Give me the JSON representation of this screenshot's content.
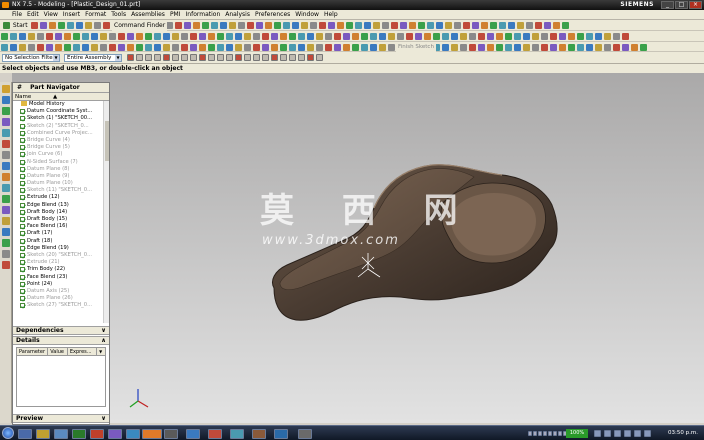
{
  "window": {
    "title": "NX 7.5 - Modeling - [Plastic_Design_01.prt]",
    "brand": "SIEMENS",
    "controls": [
      "_",
      "□",
      "×"
    ]
  },
  "menu": [
    "File",
    "Edit",
    "View",
    "Insert",
    "Format",
    "Tools",
    "Assemblies",
    "PMI",
    "Information",
    "Analysis",
    "Preferences",
    "Window",
    "Help"
  ],
  "toolbar": {
    "start_label": "Start",
    "command_finder": "Command Finder",
    "sketch_label": "Finish Sketch"
  },
  "filter": {
    "selection_filter": "No Selection Filter",
    "scope": "Entire Assembly"
  },
  "cue_line": "Select objects and use MB3, or double-click an object",
  "navigator": {
    "title": "Part Navigator",
    "column_name": "Name",
    "items": [
      {
        "label": "Model History",
        "dim": false,
        "root": true
      },
      {
        "label": "Datum Coordinate Syst...",
        "dim": false
      },
      {
        "label": "Sketch (1) \"SKETCH_00...",
        "dim": false
      },
      {
        "label": "Sketch (2) \"SKETCH_0...",
        "dim": true
      },
      {
        "label": "Combined Curve Projec...",
        "dim": true
      },
      {
        "label": "Bridge Curve (4)",
        "dim": true
      },
      {
        "label": "Bridge Curve (5)",
        "dim": true
      },
      {
        "label": "Join Curve (6)",
        "dim": true
      },
      {
        "label": "N-Sided Surface (7)",
        "dim": true
      },
      {
        "label": "Datum Plane (8)",
        "dim": true
      },
      {
        "label": "Datum Plane (9)",
        "dim": true
      },
      {
        "label": "Datum Plane (10)",
        "dim": true
      },
      {
        "label": "Sketch (11) \"SKETCH_0...",
        "dim": true
      },
      {
        "label": "Extrude (12)",
        "dim": false
      },
      {
        "label": "Edge Blend (13)",
        "dim": false
      },
      {
        "label": "Draft Body (14)",
        "dim": false
      },
      {
        "label": "Draft Body (15)",
        "dim": false
      },
      {
        "label": "Face Blend (16)",
        "dim": false
      },
      {
        "label": "Draft (17)",
        "dim": false
      },
      {
        "label": "Draft (18)",
        "dim": false
      },
      {
        "label": "Edge Blend (19)",
        "dim": false
      },
      {
        "label": "Sketch (20) \"SKETCH_0...",
        "dim": true
      },
      {
        "label": "Extrude (21)",
        "dim": true
      },
      {
        "label": "Trim Body (22)",
        "dim": false
      },
      {
        "label": "Face Blend (23)",
        "dim": false
      },
      {
        "label": "Point (24)",
        "dim": false
      },
      {
        "label": "Datum Axis (25)",
        "dim": true
      },
      {
        "label": "Datum Plane (26)",
        "dim": true
      },
      {
        "label": "Sketch (27) \"SKETCH_0...",
        "dim": true
      }
    ],
    "dependencies_label": "Dependencies",
    "details_label": "Details",
    "details_columns": [
      "Parameter",
      "Value",
      "Expres..."
    ],
    "preview_label": "Preview"
  },
  "watermark": {
    "line1": "莫 西 网",
    "line2": "www.3dmox.com"
  },
  "taskbar": {
    "battery": "100%",
    "clock": "03:50 p.m."
  },
  "colors": {
    "model_body": "#4a3c32",
    "model_edge": "#2a211b",
    "viewport_top": "#aaa9a9",
    "viewport_bottom": "#e2e2e2"
  }
}
